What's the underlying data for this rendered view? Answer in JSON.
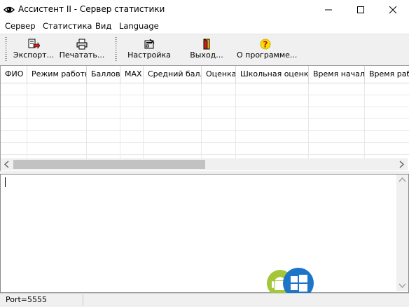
{
  "window": {
    "title": "Ассистент II - Сервер статистики"
  },
  "menu": {
    "items": [
      "Сервер",
      "Статистика",
      "Вид",
      "Language"
    ]
  },
  "toolbar": {
    "export_label": "Экспорт...",
    "print_label": "Печатать...",
    "settings_label": "Настройка",
    "exit_label": "Выход...",
    "about_label": "О программе..."
  },
  "table": {
    "columns": [
      "ФИО",
      "Режим работы",
      "Баллов",
      "MAX",
      "Средний балл",
      "Оценка",
      "Школьная оценка",
      "Время начала",
      "Время работы"
    ]
  },
  "status": {
    "port": "Port=5555"
  },
  "colors": {
    "accent_blue": "#1c75c8",
    "android_green": "#a4c639"
  }
}
